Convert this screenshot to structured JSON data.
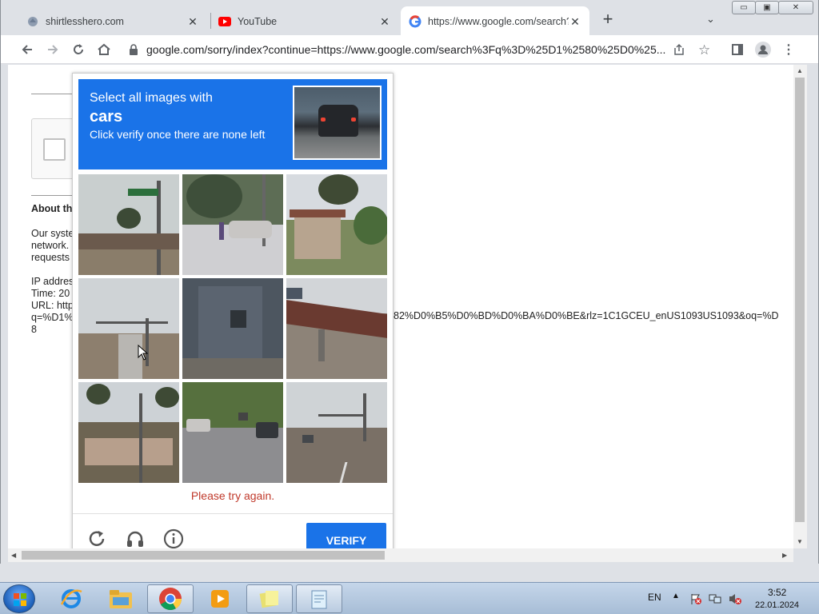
{
  "browser": {
    "tabs": [
      {
        "title": "shirtlesshero.com",
        "active": false
      },
      {
        "title": "YouTube",
        "active": false
      },
      {
        "title": "https://www.google.com/search?q=",
        "active": true
      }
    ],
    "new_tab": "+",
    "address": "google.com/sorry/index?continue=https://www.google.com/search%3Fq%3D%25D1%2580%25D0%25..."
  },
  "page": {
    "about_heading": "About th",
    "body_lines": [
      "Our syste",
      "network.",
      "requests"
    ],
    "ip_label": "IP addres",
    "time_label": "Time: 20",
    "url_label": "URL: http",
    "q_label": "q=%D1%",
    "trailing_digit": "8",
    "url_overflow": "82%D0%B5%D0%BD%D0%BA%D0%BE&rlz=1C1GCEU_enUS1093US1093&oq=%D"
  },
  "captcha": {
    "instruction_line1": "Select all images with",
    "target": "cars",
    "instruction_line3": "Click verify once there are none left",
    "error": "Please try again.",
    "verify_label": "VERIFY",
    "tiles": [
      "street-sign-palm",
      "car-on-sidewalk",
      "palm-house",
      "road-traffic-pole",
      "house-wall",
      "bridge",
      "palm-building",
      "street-cars",
      "intersection"
    ]
  },
  "taskbar": {
    "language": "EN",
    "time": "3:52",
    "date": "22.01.2024"
  }
}
